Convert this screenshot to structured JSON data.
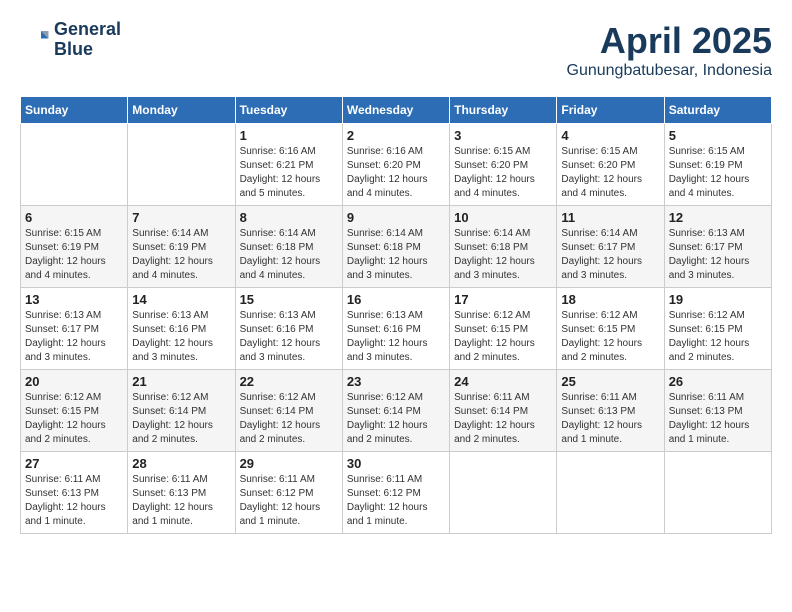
{
  "logo": {
    "line1": "General",
    "line2": "Blue"
  },
  "title": "April 2025",
  "subtitle": "Gunungbatubesar, Indonesia",
  "weekdays": [
    "Sunday",
    "Monday",
    "Tuesday",
    "Wednesday",
    "Thursday",
    "Friday",
    "Saturday"
  ],
  "weeks": [
    [
      {
        "day": "",
        "info": ""
      },
      {
        "day": "",
        "info": ""
      },
      {
        "day": "1",
        "info": "Sunrise: 6:16 AM\nSunset: 6:21 PM\nDaylight: 12 hours\nand 5 minutes."
      },
      {
        "day": "2",
        "info": "Sunrise: 6:16 AM\nSunset: 6:20 PM\nDaylight: 12 hours\nand 4 minutes."
      },
      {
        "day": "3",
        "info": "Sunrise: 6:15 AM\nSunset: 6:20 PM\nDaylight: 12 hours\nand 4 minutes."
      },
      {
        "day": "4",
        "info": "Sunrise: 6:15 AM\nSunset: 6:20 PM\nDaylight: 12 hours\nand 4 minutes."
      },
      {
        "day": "5",
        "info": "Sunrise: 6:15 AM\nSunset: 6:19 PM\nDaylight: 12 hours\nand 4 minutes."
      }
    ],
    [
      {
        "day": "6",
        "info": "Sunrise: 6:15 AM\nSunset: 6:19 PM\nDaylight: 12 hours\nand 4 minutes."
      },
      {
        "day": "7",
        "info": "Sunrise: 6:14 AM\nSunset: 6:19 PM\nDaylight: 12 hours\nand 4 minutes."
      },
      {
        "day": "8",
        "info": "Sunrise: 6:14 AM\nSunset: 6:18 PM\nDaylight: 12 hours\nand 4 minutes."
      },
      {
        "day": "9",
        "info": "Sunrise: 6:14 AM\nSunset: 6:18 PM\nDaylight: 12 hours\nand 3 minutes."
      },
      {
        "day": "10",
        "info": "Sunrise: 6:14 AM\nSunset: 6:18 PM\nDaylight: 12 hours\nand 3 minutes."
      },
      {
        "day": "11",
        "info": "Sunrise: 6:14 AM\nSunset: 6:17 PM\nDaylight: 12 hours\nand 3 minutes."
      },
      {
        "day": "12",
        "info": "Sunrise: 6:13 AM\nSunset: 6:17 PM\nDaylight: 12 hours\nand 3 minutes."
      }
    ],
    [
      {
        "day": "13",
        "info": "Sunrise: 6:13 AM\nSunset: 6:17 PM\nDaylight: 12 hours\nand 3 minutes."
      },
      {
        "day": "14",
        "info": "Sunrise: 6:13 AM\nSunset: 6:16 PM\nDaylight: 12 hours\nand 3 minutes."
      },
      {
        "day": "15",
        "info": "Sunrise: 6:13 AM\nSunset: 6:16 PM\nDaylight: 12 hours\nand 3 minutes."
      },
      {
        "day": "16",
        "info": "Sunrise: 6:13 AM\nSunset: 6:16 PM\nDaylight: 12 hours\nand 3 minutes."
      },
      {
        "day": "17",
        "info": "Sunrise: 6:12 AM\nSunset: 6:15 PM\nDaylight: 12 hours\nand 2 minutes."
      },
      {
        "day": "18",
        "info": "Sunrise: 6:12 AM\nSunset: 6:15 PM\nDaylight: 12 hours\nand 2 minutes."
      },
      {
        "day": "19",
        "info": "Sunrise: 6:12 AM\nSunset: 6:15 PM\nDaylight: 12 hours\nand 2 minutes."
      }
    ],
    [
      {
        "day": "20",
        "info": "Sunrise: 6:12 AM\nSunset: 6:15 PM\nDaylight: 12 hours\nand 2 minutes."
      },
      {
        "day": "21",
        "info": "Sunrise: 6:12 AM\nSunset: 6:14 PM\nDaylight: 12 hours\nand 2 minutes."
      },
      {
        "day": "22",
        "info": "Sunrise: 6:12 AM\nSunset: 6:14 PM\nDaylight: 12 hours\nand 2 minutes."
      },
      {
        "day": "23",
        "info": "Sunrise: 6:12 AM\nSunset: 6:14 PM\nDaylight: 12 hours\nand 2 minutes."
      },
      {
        "day": "24",
        "info": "Sunrise: 6:11 AM\nSunset: 6:14 PM\nDaylight: 12 hours\nand 2 minutes."
      },
      {
        "day": "25",
        "info": "Sunrise: 6:11 AM\nSunset: 6:13 PM\nDaylight: 12 hours\nand 1 minute."
      },
      {
        "day": "26",
        "info": "Sunrise: 6:11 AM\nSunset: 6:13 PM\nDaylight: 12 hours\nand 1 minute."
      }
    ],
    [
      {
        "day": "27",
        "info": "Sunrise: 6:11 AM\nSunset: 6:13 PM\nDaylight: 12 hours\nand 1 minute."
      },
      {
        "day": "28",
        "info": "Sunrise: 6:11 AM\nSunset: 6:13 PM\nDaylight: 12 hours\nand 1 minute."
      },
      {
        "day": "29",
        "info": "Sunrise: 6:11 AM\nSunset: 6:12 PM\nDaylight: 12 hours\nand 1 minute."
      },
      {
        "day": "30",
        "info": "Sunrise: 6:11 AM\nSunset: 6:12 PM\nDaylight: 12 hours\nand 1 minute."
      },
      {
        "day": "",
        "info": ""
      },
      {
        "day": "",
        "info": ""
      },
      {
        "day": "",
        "info": ""
      }
    ]
  ]
}
